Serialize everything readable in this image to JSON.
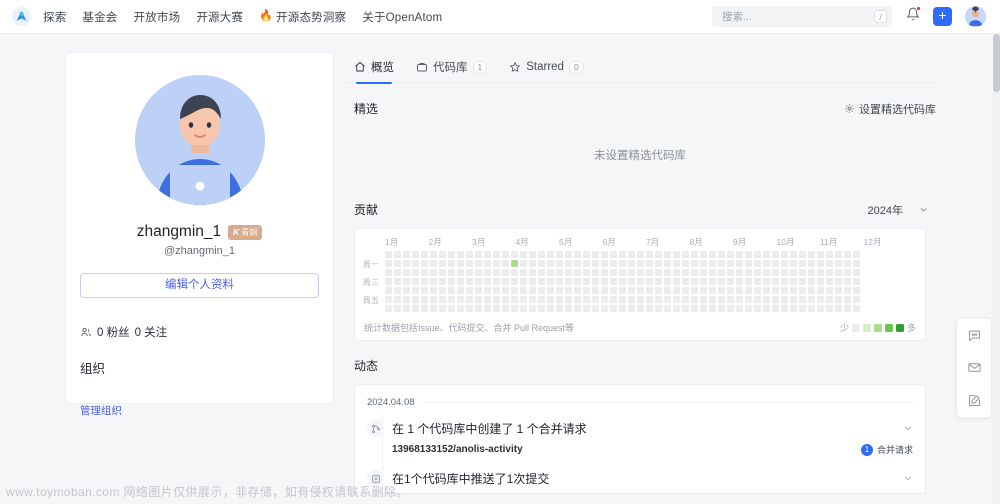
{
  "topnav": {
    "logo_icon": "openatom-logo-icon",
    "links": [
      {
        "label": "探索",
        "icon": null
      },
      {
        "label": "基金会",
        "icon": null
      },
      {
        "label": "开放市场",
        "icon": null
      },
      {
        "label": "开源大赛",
        "icon": null
      },
      {
        "label": "开源态势洞察",
        "icon": "flame-icon"
      },
      {
        "label": "关于OpenAtom",
        "icon": null
      }
    ],
    "search": {
      "placeholder": "搜索...",
      "shortcut": "/"
    },
    "notification_icon": "bell-icon",
    "create_label": "+",
    "avatar_icon": "user-avatar"
  },
  "profile": {
    "avatar_icon": "person-laptop-avatar",
    "username": "zhangmin_1",
    "badge": {
      "mark": "K",
      "label": "青铜"
    },
    "handle": "@zhangmin_1",
    "edit_button": "编辑个人资料",
    "stats_icon": "people-icon",
    "followers": "0 粉丝",
    "following": "0 关注",
    "org_title": "组织",
    "org_link": "管理组织"
  },
  "tabs": [
    {
      "label": "概览",
      "icon": "home-icon",
      "count": null,
      "active": true
    },
    {
      "label": "代码库",
      "icon": "repo-icon",
      "count": "1",
      "active": false
    },
    {
      "label": "Starred",
      "icon": "star-icon",
      "count": "0",
      "active": false
    }
  ],
  "featured": {
    "title": "精选",
    "action_label": "设置精选代码库",
    "action_icon": "settings-icon",
    "empty_text": "未设置精选代码库"
  },
  "contributions": {
    "title": "贡献",
    "year": "2024年",
    "year_chevron_icon": "chevron-down-icon",
    "note": "统计数据包括Issue、代码提交、合并 Pull Request等",
    "legend_less": "少",
    "legend_more": "多",
    "months": [
      "1月",
      "2月",
      "3月",
      "4月",
      "5月",
      "6月",
      "7月",
      "8月",
      "9月",
      "10月",
      "11月",
      "12月"
    ],
    "weekdays": [
      "",
      "周一",
      "",
      "周三",
      "",
      "周五",
      ""
    ]
  },
  "chart_data": {
    "type": "heatmap",
    "title": "贡献",
    "subtitle": "2024年",
    "xlabel": "",
    "ylabel": "",
    "x_tick_labels": [
      "1月",
      "2月",
      "3月",
      "4月",
      "5月",
      "6月",
      "7月",
      "8月",
      "9月",
      "10月",
      "11月",
      "12月"
    ],
    "y_tick_labels": [
      "",
      "周一",
      "",
      "周三",
      "",
      "周五",
      ""
    ],
    "rows": 7,
    "columns": 53,
    "levels": [
      0,
      1,
      2,
      3,
      4
    ],
    "level_colors": [
      "#ececec",
      "#d4eec0",
      "#a8dd86",
      "#6fc44b",
      "#2f9e2f"
    ],
    "legend": {
      "less": "少",
      "more": "多",
      "position": "bottom-right"
    },
    "nonzero_points": [
      {
        "row": 1,
        "col": 14,
        "value": 1,
        "level": 2,
        "approx_date": "2024-04-08"
      }
    ],
    "total_contributions": 1,
    "note": "统计数据包括Issue、代码提交、合并 Pull Request等"
  },
  "activity": {
    "title": "动态",
    "date": "2024.04.08",
    "items": [
      {
        "icon": "merge-request-icon",
        "title": "在 1 个代码库中创建了 1 个合并请求",
        "repo": "13968133152/anolis-activity",
        "tag_count": "1",
        "tag_label": "合并请求",
        "chevron_icon": "chevron-down-icon"
      },
      {
        "icon": "push-commit-icon",
        "title": "在1个代码库中推送了1次提交",
        "repo": null,
        "tag_count": null,
        "tag_label": null,
        "chevron_icon": "chevron-down-icon"
      }
    ]
  },
  "float_toolbar": [
    {
      "icon": "chat-icon"
    },
    {
      "icon": "envelope-icon"
    },
    {
      "icon": "edit-pencil-icon"
    }
  ],
  "watermark": "www.toymoban.com 网络图片仅供展示，非存储，如有侵权请联系删除。",
  "colors": {
    "accent": "#2f6bff",
    "link": "#4b62e8",
    "badge": "#d9ab8e",
    "heat_max": "#2f9e2f"
  }
}
